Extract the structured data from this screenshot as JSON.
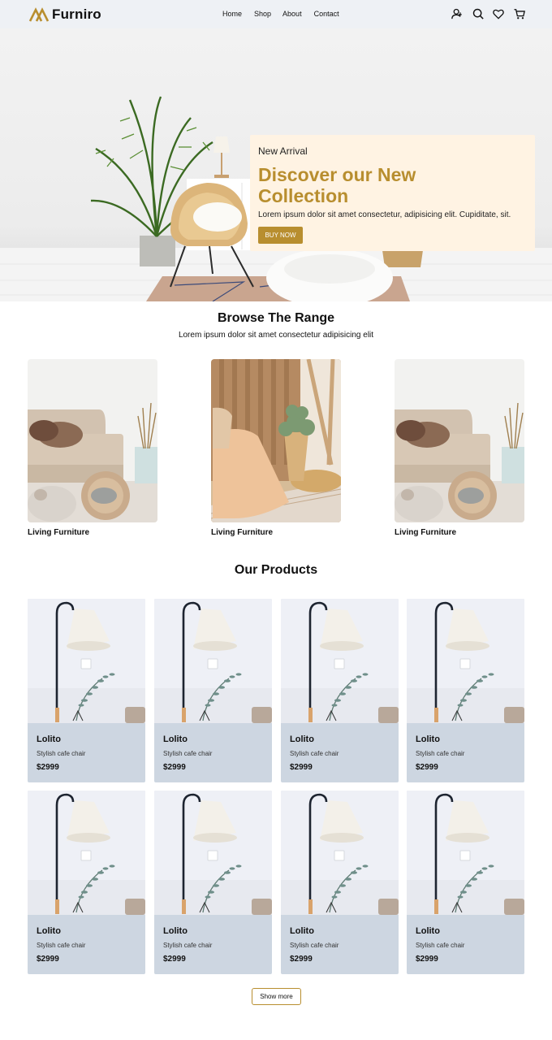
{
  "brand": {
    "name": "Furniro",
    "accent": "#b88e2f"
  },
  "nav": {
    "links": [
      "Home",
      "Shop",
      "About",
      "Contact"
    ]
  },
  "header_icons": [
    "user-icon",
    "search-icon",
    "heart-icon",
    "cart-icon"
  ],
  "hero": {
    "kicker": "New Arrival",
    "title": "Discover our New Collection",
    "text": "Lorem ipsum dolor sit amet consectetur, adipisicing elit. Cupiditate, sit.",
    "button": "BUY NOW"
  },
  "browse": {
    "title": "Browse The Range",
    "subtitle": "Lorem ipsum dolor sit amet consectetur adipisicing elit",
    "items": [
      {
        "label": "Living Furniture"
      },
      {
        "label": "Living Furniture"
      },
      {
        "label": "Living Furniture"
      }
    ]
  },
  "products": {
    "title": "Our Products",
    "items": [
      {
        "name": "Lolito",
        "desc": "Stylish cafe chair",
        "price": "$2999"
      },
      {
        "name": "Lolito",
        "desc": "Stylish cafe chair",
        "price": "$2999"
      },
      {
        "name": "Lolito",
        "desc": "Stylish cafe chair",
        "price": "$2999"
      },
      {
        "name": "Lolito",
        "desc": "Stylish cafe chair",
        "price": "$2999"
      },
      {
        "name": "Lolito",
        "desc": "Stylish cafe chair",
        "price": "$2999"
      },
      {
        "name": "Lolito",
        "desc": "Stylish cafe chair",
        "price": "$2999"
      },
      {
        "name": "Lolito",
        "desc": "Stylish cafe chair",
        "price": "$2999"
      },
      {
        "name": "Lolito",
        "desc": "Stylish cafe chair",
        "price": "$2999"
      }
    ],
    "show_more": "Show more"
  }
}
